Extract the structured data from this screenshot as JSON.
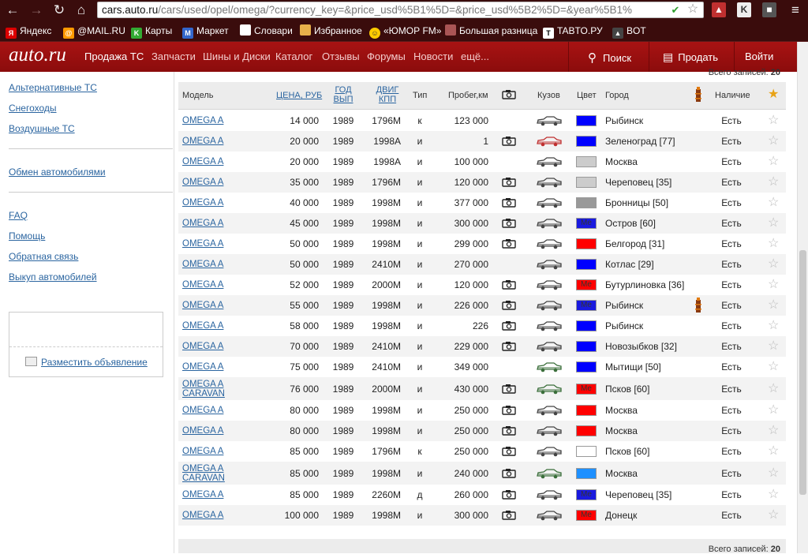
{
  "browser": {
    "url_host": "cars.auto.ru",
    "url_rest": "/cars/used/opel/omega/?currency_key=&price_usd%5B1%5D=&price_usd%5B2%5D=&year%5B1%",
    "bookmarks": [
      "Яндекс",
      "@MAIL.RU",
      "Карты",
      "Маркет",
      "Словари",
      "Избранное",
      "«ЮМОР FM»",
      "Большая разница",
      "TABTO.РУ",
      "BOT"
    ]
  },
  "header": {
    "logo": "auto.ru",
    "nav": [
      "Продажа ТС",
      "Запчасти",
      "Шины и Диски",
      "Каталог",
      "Отзывы",
      "Форумы",
      "Новости",
      "ещё..."
    ],
    "search": "Поиск",
    "sell": "Продать",
    "login": "Войти"
  },
  "sidebar": {
    "group1": [
      "Альтернативные ТС",
      "Снегоходы",
      "Воздушные ТС"
    ],
    "group2": [
      "Обмен автомобилями"
    ],
    "group3": [
      "FAQ",
      "Помощь",
      "Обратная связь",
      "Выкуп автомобилей"
    ],
    "post_ad": "Разместить объявление"
  },
  "totals": {
    "label": "Всего записей:",
    "count": "20"
  },
  "table": {
    "columns": {
      "model": "Модель",
      "price": "ЦЕНА, РУБ",
      "year": [
        "ГОД",
        "ВЫП"
      ],
      "engine": [
        "ДВИГ",
        "КПП"
      ],
      "type": "Тип",
      "mileage": "Пробег,км",
      "body": "Кузов",
      "color": "Цвет",
      "city": "Город",
      "avail": "Наличие"
    },
    "rows": [
      {
        "model": "OMEGA A",
        "price": "14 000",
        "year": "1989",
        "engine": "1796M",
        "type": "к",
        "mileage": "123 000",
        "photo": false,
        "body_color": "#444",
        "color": "#0000ff",
        "color_label": "",
        "city": "Рыбинск",
        "tower": false,
        "avail": "Есть"
      },
      {
        "model": "OMEGA A",
        "price": "20 000",
        "year": "1989",
        "engine": "1998A",
        "type": "и",
        "mileage": "1",
        "photo": true,
        "body_color": "#c03030",
        "color": "#0000ff",
        "color_label": "",
        "city": "Зеленоград [77]",
        "tower": false,
        "avail": "Есть"
      },
      {
        "model": "OMEGA A",
        "price": "20 000",
        "year": "1989",
        "engine": "1998A",
        "type": "и",
        "mileage": "100 000",
        "photo": false,
        "body_color": "#444",
        "color": "#cccccc",
        "color_label": "",
        "city": "Москва",
        "tower": false,
        "avail": "Есть"
      },
      {
        "model": "OMEGA A",
        "price": "35 000",
        "year": "1989",
        "engine": "1796M",
        "type": "и",
        "mileage": "120 000",
        "photo": true,
        "body_color": "#444",
        "color": "#cccccc",
        "color_label": "",
        "city": "Череповец [35]",
        "tower": false,
        "avail": "Есть"
      },
      {
        "model": "OMEGA A",
        "price": "40 000",
        "year": "1989",
        "engine": "1998M",
        "type": "и",
        "mileage": "377 000",
        "photo": true,
        "body_color": "#444",
        "color": "#999999",
        "color_label": "",
        "city": "Бронницы [50]",
        "tower": false,
        "avail": "Есть"
      },
      {
        "model": "OMEGA A",
        "price": "45 000",
        "year": "1989",
        "engine": "1998M",
        "type": "и",
        "mileage": "300 000",
        "photo": true,
        "body_color": "#444",
        "color": "#1a1adf",
        "color_label": "Ме",
        "city": "Остров [60]",
        "tower": false,
        "avail": "Есть"
      },
      {
        "model": "OMEGA A",
        "price": "50 000",
        "year": "1989",
        "engine": "1998M",
        "type": "и",
        "mileage": "299 000",
        "photo": true,
        "body_color": "#444",
        "color": "#ff0000",
        "color_label": "",
        "city": "Белгород [31]",
        "tower": false,
        "avail": "Есть"
      },
      {
        "model": "OMEGA A",
        "price": "50 000",
        "year": "1989",
        "engine": "2410M",
        "type": "и",
        "mileage": "270 000",
        "photo": false,
        "body_color": "#444",
        "color": "#0000ff",
        "color_label": "",
        "city": "Котлас [29]",
        "tower": false,
        "avail": "Есть"
      },
      {
        "model": "OMEGA A",
        "price": "52 000",
        "year": "1989",
        "engine": "2000M",
        "type": "и",
        "mileage": "120 000",
        "photo": true,
        "body_color": "#444",
        "color": "#ff0000",
        "color_label": "Ме",
        "city": "Бутурлиновка [36]",
        "tower": false,
        "avail": "Есть"
      },
      {
        "model": "OMEGA A",
        "price": "55 000",
        "year": "1989",
        "engine": "1998M",
        "type": "и",
        "mileage": "226 000",
        "photo": true,
        "body_color": "#444",
        "color": "#1a1adf",
        "color_label": "Ме",
        "city": "Рыбинск",
        "tower": true,
        "avail": "Есть"
      },
      {
        "model": "OMEGA A",
        "price": "58 000",
        "year": "1989",
        "engine": "1998M",
        "type": "и",
        "mileage": "226",
        "photo": true,
        "body_color": "#444",
        "color": "#0000ff",
        "color_label": "",
        "city": "Рыбинск",
        "tower": false,
        "avail": "Есть"
      },
      {
        "model": "OMEGA A",
        "price": "70 000",
        "year": "1989",
        "engine": "2410M",
        "type": "и",
        "mileage": "229 000",
        "photo": true,
        "body_color": "#444",
        "color": "#0000ff",
        "color_label": "",
        "city": "Новозыбков [32]",
        "tower": false,
        "avail": "Есть"
      },
      {
        "model": "OMEGA A",
        "price": "75 000",
        "year": "1989",
        "engine": "2410M",
        "type": "и",
        "mileage": "349 000",
        "photo": false,
        "body_color": "#3a6e3a",
        "color": "#0000ff",
        "color_label": "",
        "city": "Мытищи [50]",
        "tower": false,
        "avail": "Есть"
      },
      {
        "model": "OMEGA A CARAVAN",
        "price": "76 000",
        "year": "1989",
        "engine": "2000M",
        "type": "и",
        "mileage": "430 000",
        "photo": true,
        "body_color": "#3a6e3a",
        "color": "#ff0000",
        "color_label": "Ме",
        "city": "Псков [60]",
        "tower": false,
        "avail": "Есть"
      },
      {
        "model": "OMEGA A",
        "price": "80 000",
        "year": "1989",
        "engine": "1998M",
        "type": "и",
        "mileage": "250 000",
        "photo": true,
        "body_color": "#444",
        "color": "#ff0000",
        "color_label": "",
        "city": "Москва",
        "tower": false,
        "avail": "Есть"
      },
      {
        "model": "OMEGA A",
        "price": "80 000",
        "year": "1989",
        "engine": "1998M",
        "type": "и",
        "mileage": "250 000",
        "photo": true,
        "body_color": "#444",
        "color": "#ff0000",
        "color_label": "",
        "city": "Москва",
        "tower": false,
        "avail": "Есть"
      },
      {
        "model": "OMEGA A",
        "price": "85 000",
        "year": "1989",
        "engine": "1796M",
        "type": "к",
        "mileage": "250 000",
        "photo": true,
        "body_color": "#444",
        "color": "#ffffff",
        "color_label": "",
        "city": "Псков [60]",
        "tower": false,
        "avail": "Есть"
      },
      {
        "model": "OMEGA A CARAVAN",
        "price": "85 000",
        "year": "1989",
        "engine": "1998M",
        "type": "и",
        "mileage": "240 000",
        "photo": true,
        "body_color": "#3a6e3a",
        "color": "#1e90ff",
        "color_label": "",
        "city": "Москва",
        "tower": false,
        "avail": "Есть"
      },
      {
        "model": "OMEGA A",
        "price": "85 000",
        "year": "1989",
        "engine": "2260M",
        "type": "д",
        "mileage": "260 000",
        "photo": true,
        "body_color": "#444",
        "color": "#1a1adf",
        "color_label": "Ме",
        "city": "Череповец [35]",
        "tower": false,
        "avail": "Есть"
      },
      {
        "model": "OMEGA A",
        "price": "100 000",
        "year": "1989",
        "engine": "1998M",
        "type": "и",
        "mileage": "300 000",
        "photo": true,
        "body_color": "#444",
        "color": "#ff0000",
        "color_label": "Ме",
        "city": "Донецк",
        "tower": false,
        "avail": "Есть"
      }
    ]
  }
}
